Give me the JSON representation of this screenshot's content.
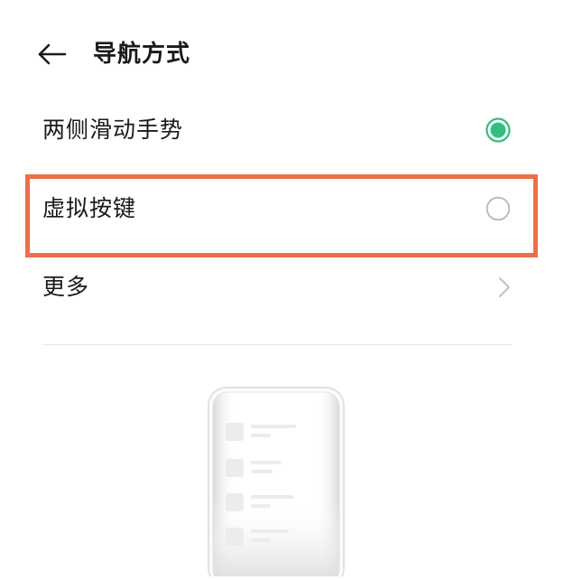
{
  "header": {
    "title": "导航方式",
    "back_icon": "arrow-left-icon"
  },
  "options": [
    {
      "label": "两侧滑动手势",
      "selected": true
    },
    {
      "label": "虚拟按键",
      "selected": false
    },
    {
      "label": "更多"
    }
  ],
  "colors": {
    "accent": "#2fbf7f",
    "highlight": "#ee6e48",
    "radio_off": "#b8b8b8",
    "chevron": "#c2c2c2",
    "divider": "#e8e8e8"
  }
}
